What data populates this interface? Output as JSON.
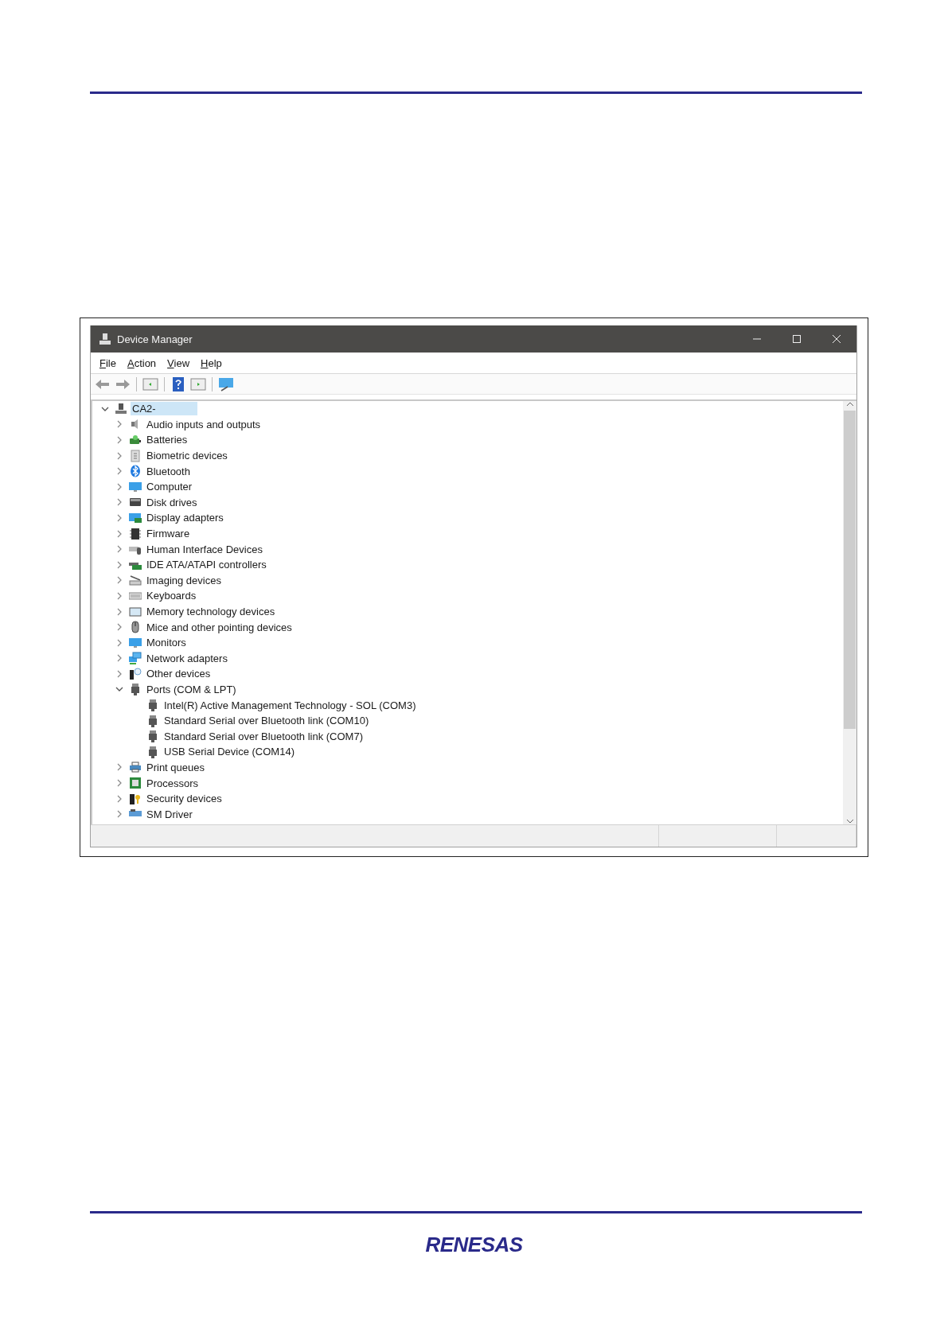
{
  "window": {
    "title": "Device Manager"
  },
  "menu": [
    "File",
    "Action",
    "View",
    "Help"
  ],
  "tree": {
    "label": "CA2-",
    "expanded": true,
    "selected": true,
    "children": [
      {
        "label": "Audio inputs and outputs",
        "expanded": false
      },
      {
        "label": "Batteries",
        "expanded": false
      },
      {
        "label": "Biometric devices",
        "expanded": false
      },
      {
        "label": "Bluetooth",
        "expanded": false
      },
      {
        "label": "Computer",
        "expanded": false
      },
      {
        "label": "Disk drives",
        "expanded": false
      },
      {
        "label": "Display adapters",
        "expanded": false
      },
      {
        "label": "Firmware",
        "expanded": false
      },
      {
        "label": "Human Interface Devices",
        "expanded": false
      },
      {
        "label": "IDE ATA/ATAPI controllers",
        "expanded": false
      },
      {
        "label": "Imaging devices",
        "expanded": false
      },
      {
        "label": "Keyboards",
        "expanded": false
      },
      {
        "label": "Memory technology devices",
        "expanded": false
      },
      {
        "label": "Mice and other pointing devices",
        "expanded": false
      },
      {
        "label": "Monitors",
        "expanded": false
      },
      {
        "label": "Network adapters",
        "expanded": false
      },
      {
        "label": "Other devices",
        "expanded": false
      },
      {
        "label": "Ports (COM & LPT)",
        "expanded": true,
        "children": [
          {
            "label": "Intel(R) Active Management Technology - SOL (COM3)"
          },
          {
            "label": "Standard Serial over Bluetooth link (COM10)"
          },
          {
            "label": "Standard Serial over Bluetooth link (COM7)"
          },
          {
            "label": "USB Serial Device (COM14)"
          }
        ]
      },
      {
        "label": "Print queues",
        "expanded": false
      },
      {
        "label": "Processors",
        "expanded": false
      },
      {
        "label": "Security devices",
        "expanded": false
      },
      {
        "label": "SM Driver",
        "expanded": false
      }
    ]
  },
  "footer": {
    "logo": "RENESAS"
  }
}
